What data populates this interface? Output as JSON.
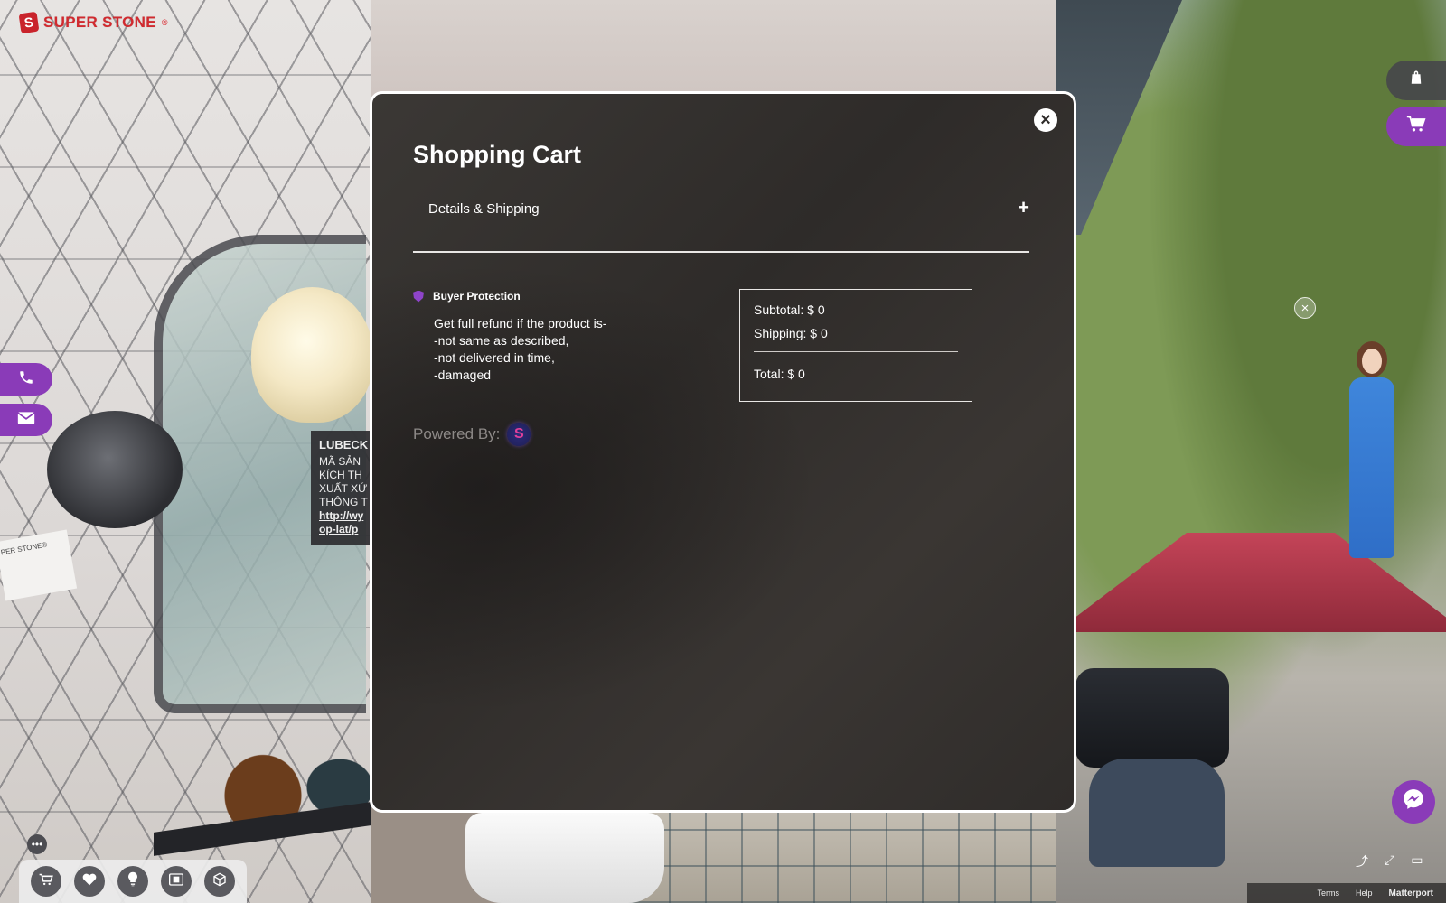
{
  "brand": {
    "logo_letter": "S",
    "name": "SUPER STONE",
    "mark": "®"
  },
  "modal": {
    "title": "Shopping Cart",
    "close_icon": "×",
    "accordion": {
      "label": "Details & Shipping",
      "toggle": "+"
    },
    "buyer_protection": {
      "title": "Buyer Protection",
      "lines": [
        "Get full refund if the product is-",
        "-not same as described,",
        "-not delivered in time,",
        "-damaged"
      ]
    },
    "summary": {
      "subtotal": "Subtotal: $ 0",
      "shipping": "Shipping: $ 0",
      "total": "Total: $ 0"
    },
    "powered_by": {
      "label": "Powered By:",
      "logo_letter": "S"
    }
  },
  "background_tooltip": {
    "title": "LUBECK",
    "lines": [
      "MÃ SẢN",
      "KÍCH TH",
      "XUẤT XỨ",
      "THÔNG T"
    ],
    "link_lines": [
      "http://wy",
      "op-lat/p"
    ]
  },
  "background_label": {
    "brand": "PER STONE®"
  },
  "side_buttons": {
    "phone_icon": "phone-icon",
    "mail_icon": "mail-icon"
  },
  "right_buttons": {
    "bag_icon": "shopping-bag-icon",
    "cart_icon": "cart-icon"
  },
  "toolbar": {
    "more_label": "•••",
    "tools": [
      "cart-icon",
      "heart-icon",
      "lightbulb-icon",
      "film-icon",
      "cube-icon"
    ]
  },
  "footer": {
    "terms": "Terms",
    "help": "Help",
    "matterport": "Matterport"
  },
  "colors": {
    "accent": "#8a3bb8",
    "brand_red": "#d12a2f",
    "modal_bg": "#2e2b29"
  }
}
